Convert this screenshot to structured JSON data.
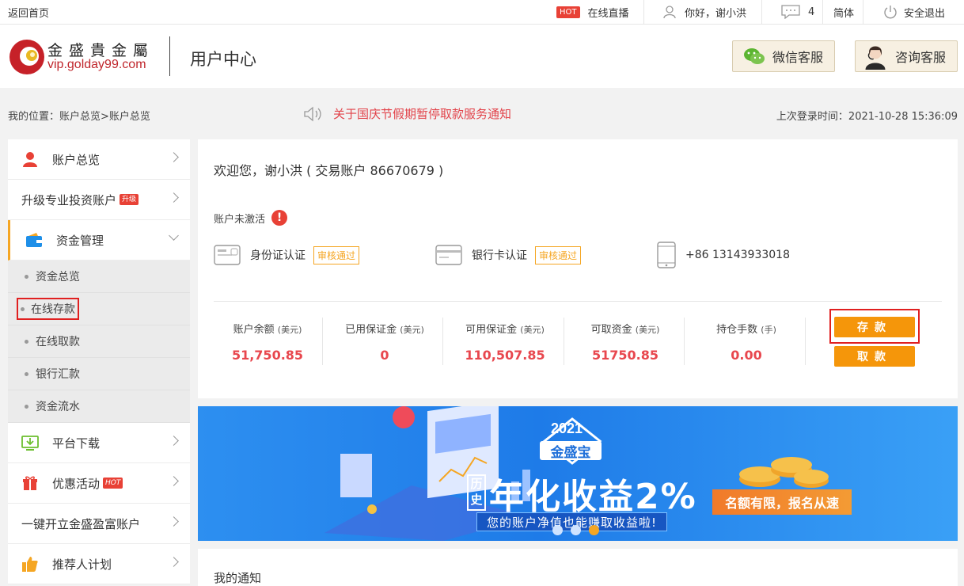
{
  "topbar": {
    "home_link": "返回首页",
    "hot_tag": "HOT",
    "live": "在线直播",
    "greeting": "你好，谢小洪",
    "message_count": "4",
    "language": "简体",
    "logout": "安全退出"
  },
  "header": {
    "logo_cn": "金盛貴金屬",
    "logo_url": "vip.golday99.com",
    "title": "用户中心",
    "wechat_service": "微信客服",
    "consult_service": "咨询客服"
  },
  "strip": {
    "location": "我的位置：账户总览>账户总览",
    "notice": "关于国庆节假期暂停取款服务通知",
    "last_login": "上次登录时间：2021-10-28 15:36:09"
  },
  "sidebar": {
    "account_overview": "账户总览",
    "upgrade": "升级专业投资账户",
    "upgrade_badge": "升级",
    "funds": "资金管理",
    "sub": [
      "资金总览",
      "在线存款",
      "在线取款",
      "银行汇款",
      "资金流水"
    ],
    "download": "平台下载",
    "promo": "优惠活动",
    "promo_badge": "HOT",
    "open_account": "一键开立金盛盈富账户",
    "referral": "推荐人计划"
  },
  "main": {
    "welcome": "欢迎您，谢小洪 ( 交易账户 86670679 )",
    "inactive": "账户未激活",
    "id_verify": "身份证认证",
    "id_status": "审核通过",
    "bank_verify": "银行卡认证",
    "bank_status": "审核通过",
    "phone": "+86 13143933018",
    "stats": [
      {
        "label": "账户余额",
        "unit": "(美元)",
        "value": "51,750.85"
      },
      {
        "label": "已用保证金",
        "unit": "(美元)",
        "value": "0"
      },
      {
        "label": "可用保证金",
        "unit": "(美元)",
        "value": "110,507.85"
      },
      {
        "label": "可取资金",
        "unit": "(美元)",
        "value": "51750.85"
      },
      {
        "label": "持仓手数",
        "unit": "(手)",
        "value": "0.00"
      }
    ],
    "deposit": "存款",
    "withdraw": "取款"
  },
  "banner": {
    "year": "2021",
    "brand": "金盛宝",
    "history": "历史",
    "headline": "年化收益2%",
    "subline": "您的账户净值也能赚取收益啦!",
    "cta": "名额有限，报名从速"
  },
  "notifications": {
    "title": "我的通知"
  },
  "colors": {
    "accent_orange": "#f5960a",
    "value_red": "#e8474e",
    "notice_red": "#e2434a",
    "highlight_border": "#e02020"
  }
}
